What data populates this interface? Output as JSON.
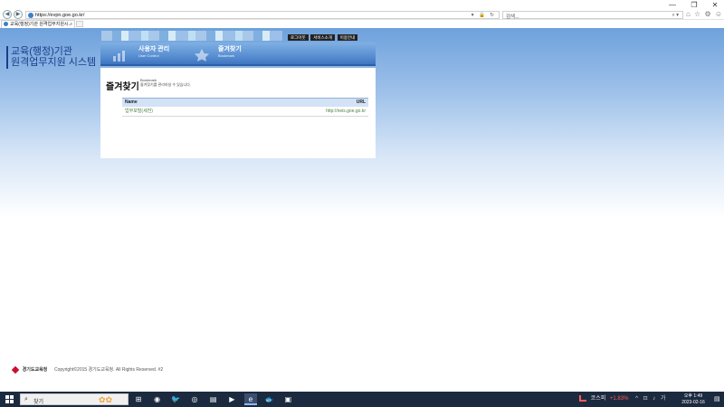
{
  "window": {
    "minimize": "—",
    "restore": "❐",
    "close": "✕"
  },
  "browser": {
    "url": "https://evpn.goe.go.kr/",
    "search_placeholder": "검색...",
    "tab_title": "교육(행정)기관 원격업무지원시...",
    "tab_close": "×",
    "nav_back": "◀",
    "nav_forward": "▶",
    "addr_tools": "▾ 🔒 ↻",
    "search_icon": "⌕ ▾",
    "tool_icons": "⌂ ☆ ⚙ ☺"
  },
  "site": {
    "title_line1": "교육(행정)기관",
    "title_line2": "원격업무지원 시스템",
    "util_buttons": [
      "로그아웃",
      "서비스소개",
      "이용안내"
    ],
    "nav": [
      {
        "label": "사용자 관리",
        "sub": "User Control"
      },
      {
        "label": "즐겨찾기",
        "sub": "Bookmark"
      }
    ]
  },
  "bookmark": {
    "heading": "즐겨찾기",
    "heading_en": "Bookmark",
    "description": "즐겨찾기를 관리하실 수 있습니다.",
    "columns": {
      "name": "Name",
      "url": "URL"
    },
    "rows": [
      {
        "name": "업무포털(세전)",
        "url": "http://neis.goe.go.kr"
      }
    ]
  },
  "footer": {
    "org": "경기도교육청",
    "copyright": "Copyright©2015 경기도교육청. All Rights Reserved. #2"
  },
  "taskbar": {
    "search_text": "찾기",
    "search_glyph": "⌕",
    "flowers": "✿✿",
    "apps": [
      "⊞",
      "◉",
      "🐦",
      "◎",
      "▤",
      "▶",
      "e",
      "🐟",
      "▣"
    ],
    "kospi_label": "코스피",
    "kospi_value": "+1.83%",
    "tray_icons": "^ ⊡ ♪ 가",
    "time": "오후 1:49",
    "date": "2023-02-16",
    "notify": "▤"
  }
}
